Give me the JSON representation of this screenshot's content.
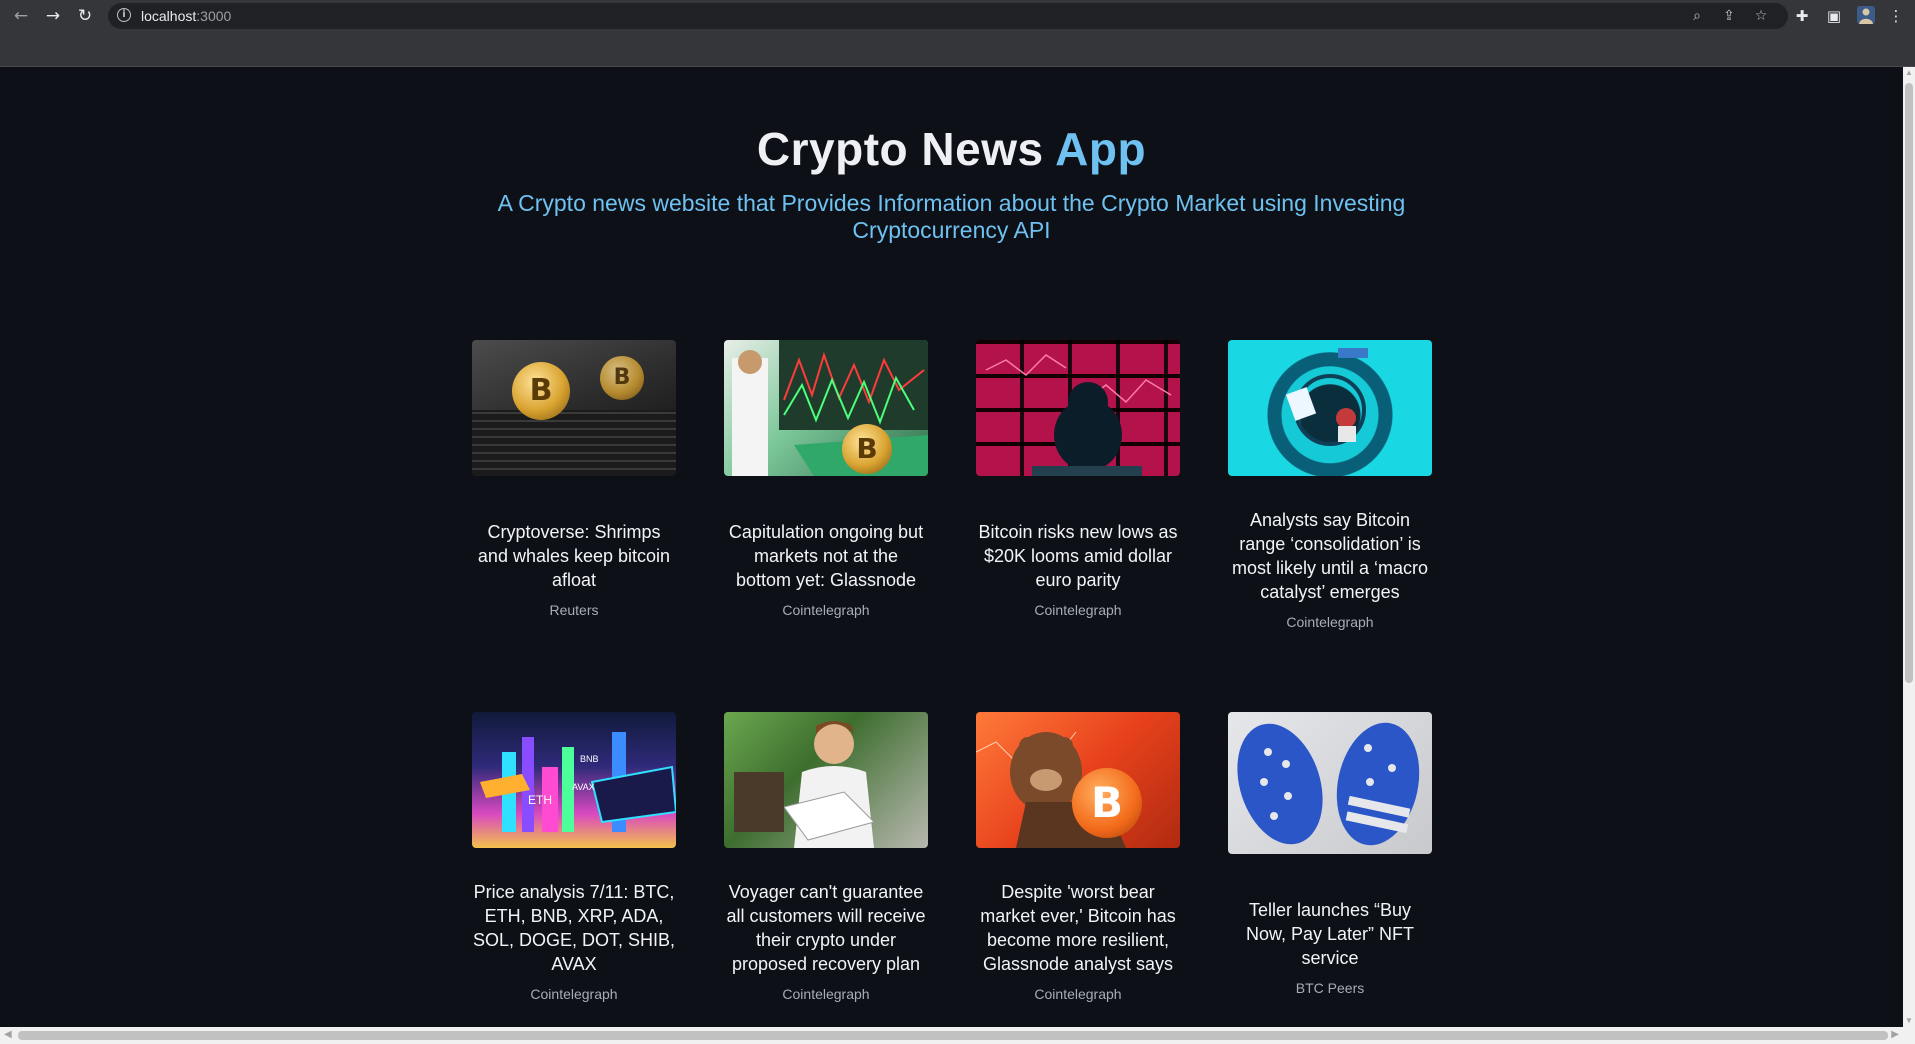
{
  "browser": {
    "url_host": "localhost",
    "url_port": ":3000"
  },
  "page": {
    "title_main": "Crypto News ",
    "title_accent": "App",
    "subtitle": "A Crypto news website that Provides Information about the Crypto Market using Investing Cryptocurrency API"
  },
  "articles": [
    {
      "headline": "Cryptoverse: Shrimps and whales keep bitcoin afloat",
      "source": "Reuters"
    },
    {
      "headline": "Capitulation ongoing but markets not at the bottom yet: Glassnode",
      "source": "Cointelegraph"
    },
    {
      "headline": "Bitcoin risks new lows as $20K looms amid dollar euro parity",
      "source": "Cointelegraph"
    },
    {
      "headline": "Analysts say Bitcoin range ‘consolidation’ is most likely until a ‘macro catalyst’ emerges",
      "source": "Cointelegraph"
    },
    {
      "headline": "Price analysis 7/11: BTC, ETH, BNB, XRP, ADA, SOL, DOGE, DOT, SHIB, AVAX",
      "source": "Cointelegraph"
    },
    {
      "headline": "Voyager can't guarantee all customers will receive their crypto under proposed recovery plan",
      "source": "Cointelegraph"
    },
    {
      "headline": "Despite 'worst bear market ever,' Bitcoin has become more resilient, Glassnode analyst says",
      "source": "Cointelegraph"
    },
    {
      "headline": "Teller launches “Buy Now, Pay Later” NFT service",
      "source": "BTC Peers"
    }
  ],
  "image_labels": {
    "coin_symbol": "B",
    "eth_label": "ETH",
    "bnb_label": "BNB",
    "avax_label": "AVAX"
  }
}
